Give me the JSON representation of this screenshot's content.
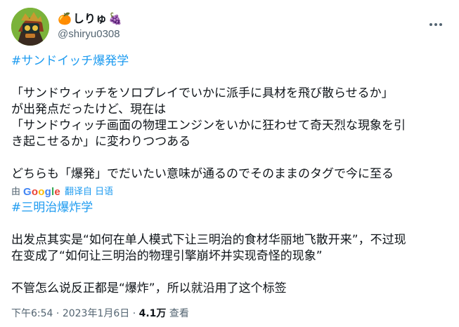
{
  "author": {
    "display_name": "しりゅ",
    "handle": "@shiryu0308",
    "emoji_left": "🍊",
    "emoji_right": "🍇"
  },
  "menu_icon": "more-dots-icon",
  "hashtag_jp": "#サンドイッチ爆発学",
  "jp_lines": [
    "「サンドウィッチをソロプレイでいかに派手に具材を飛び散らせるか」",
    "が出発点だったけど、現在は",
    "「サンドウィッチ画面の物理エンジンをいかに狂わせて奇天烈な現象を引",
    "き起こせるか」に変わりつつある"
  ],
  "jp_closing": "どちらも「爆発」でだいたい意味が通るのでそのままのタグで今に至る",
  "translation": {
    "by_label": "由",
    "google_letters": [
      "G",
      "o",
      "o",
      "g",
      "l",
      "e"
    ],
    "link_label": "翻译自 日语"
  },
  "hashtag_cn": "#三明治爆炸学",
  "cn_lines": [
    "出发点其实是“如何在单人模式下让三明治的食材华丽地飞散开来”，不过现",
    "在变成了“如何让三明治的物理引擎崩坏并实现奇怪的现象”"
  ],
  "cn_closing": "不管怎么说反正都是“爆炸”，所以就沿用了这个标签",
  "meta": {
    "time": "下午6:54",
    "separator": " · ",
    "date": "2023年1月6日",
    "views_count": "4.1万",
    "views_label": " 查看"
  },
  "colors": {
    "link": "#1d9bf0",
    "text": "#0f1419",
    "muted": "#536471",
    "google": [
      "#4285f4",
      "#ea4335",
      "#fbbc05",
      "#4285f4",
      "#34a853",
      "#ea4335"
    ]
  }
}
